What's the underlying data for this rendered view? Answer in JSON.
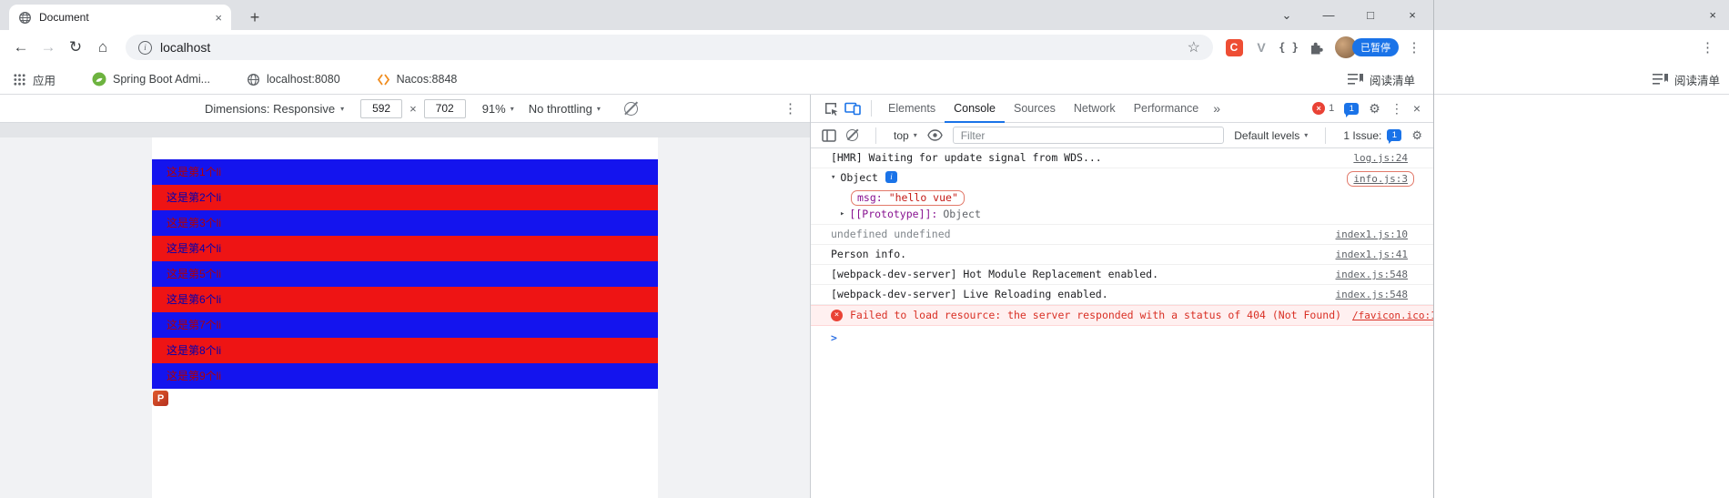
{
  "colors": {
    "accent": "#1a73e8",
    "bar_blue": "#1414ee",
    "bar_red": "#ee1414",
    "error_red": "#d93025"
  },
  "icons": {
    "back": "←",
    "forward": "→",
    "reload": "↻",
    "home": "⌂",
    "star": "☆",
    "tab_search": "⌄",
    "minimize": "—",
    "maximize": "□",
    "close": "×",
    "kebab": "⋮",
    "gear": "⚙",
    "new_tab": "+",
    "more_tabs": "»",
    "caret": "▾",
    "expand_open": "▾",
    "expand_closed": "▸",
    "prompt": ">",
    "braces": "{ }",
    "c_ext": "C",
    "v_ext": "V",
    "error_x": "×",
    "info_i": "i",
    "tab_close": "×"
  },
  "browser": {
    "tab_title": "Document",
    "url": "localhost",
    "profile_badge": "已暂停"
  },
  "bookmarks": {
    "apps_label": "应用",
    "items": [
      "Spring Boot Admi...",
      "localhost:8080",
      "Nacos:8848"
    ],
    "reading_list": "阅读清单"
  },
  "second_window": {
    "reading_list": "阅读清单"
  },
  "device_toolbar": {
    "dimensions_label": "Dimensions: Responsive",
    "width": "592",
    "times": "×",
    "height": "702",
    "zoom": "91%",
    "throttling": "No throttling"
  },
  "page": {
    "list_items": [
      "这是第1个li",
      "这是第2个li",
      "这是第3个li",
      "这是第4个li",
      "这是第5个li",
      "这是第6个li",
      "这是第7个li",
      "这是第8个li",
      "这是第9个li"
    ],
    "image_glyph": "P"
  },
  "devtools": {
    "tabs": [
      "Elements",
      "Console",
      "Sources",
      "Network",
      "Performance"
    ],
    "error_count": "1",
    "issue_count": "1",
    "console_toolbar": {
      "context": "top",
      "filter_placeholder": "Filter",
      "levels": "Default levels",
      "issues_label": "1 Issue:",
      "issues_count": "1"
    },
    "console": [
      {
        "text": "[HMR] Waiting for update signal from WDS...",
        "source": "log.js:24"
      },
      {
        "text": "Object",
        "source": "info.js:3"
      },
      {
        "key": "msg:",
        "value": "\"hello vue\""
      },
      {
        "key": "[[Prototype]]:",
        "value": "Object"
      },
      {
        "text": "undefined undefined",
        "source": "index1.js:10"
      },
      {
        "text": "Person info.",
        "source": "index1.js:41"
      },
      {
        "text": "[webpack-dev-server] Hot Module Replacement enabled.",
        "source": "index.js:548"
      },
      {
        "text": "[webpack-dev-server] Live Reloading enabled.",
        "source": "index.js:548"
      },
      {
        "text": "Failed to load resource: the server responded with a status of 404 (Not Found)",
        "source": "/favicon.ico:1"
      }
    ]
  }
}
